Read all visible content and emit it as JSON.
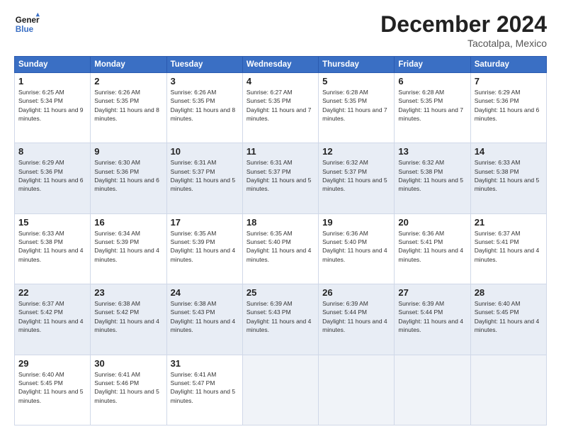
{
  "logo": {
    "line1": "General",
    "line2": "Blue"
  },
  "title": "December 2024",
  "location": "Tacotalpa, Mexico",
  "days_header": [
    "Sunday",
    "Monday",
    "Tuesday",
    "Wednesday",
    "Thursday",
    "Friday",
    "Saturday"
  ],
  "weeks": [
    {
      "shaded": false,
      "days": [
        {
          "num": "1",
          "sunrise": "6:25 AM",
          "sunset": "5:34 PM",
          "daylight": "11 hours and 9 minutes."
        },
        {
          "num": "2",
          "sunrise": "6:26 AM",
          "sunset": "5:35 PM",
          "daylight": "11 hours and 8 minutes."
        },
        {
          "num": "3",
          "sunrise": "6:26 AM",
          "sunset": "5:35 PM",
          "daylight": "11 hours and 8 minutes."
        },
        {
          "num": "4",
          "sunrise": "6:27 AM",
          "sunset": "5:35 PM",
          "daylight": "11 hours and 7 minutes."
        },
        {
          "num": "5",
          "sunrise": "6:28 AM",
          "sunset": "5:35 PM",
          "daylight": "11 hours and 7 minutes."
        },
        {
          "num": "6",
          "sunrise": "6:28 AM",
          "sunset": "5:35 PM",
          "daylight": "11 hours and 7 minutes."
        },
        {
          "num": "7",
          "sunrise": "6:29 AM",
          "sunset": "5:36 PM",
          "daylight": "11 hours and 6 minutes."
        }
      ]
    },
    {
      "shaded": true,
      "days": [
        {
          "num": "8",
          "sunrise": "6:29 AM",
          "sunset": "5:36 PM",
          "daylight": "11 hours and 6 minutes."
        },
        {
          "num": "9",
          "sunrise": "6:30 AM",
          "sunset": "5:36 PM",
          "daylight": "11 hours and 6 minutes."
        },
        {
          "num": "10",
          "sunrise": "6:31 AM",
          "sunset": "5:37 PM",
          "daylight": "11 hours and 5 minutes."
        },
        {
          "num": "11",
          "sunrise": "6:31 AM",
          "sunset": "5:37 PM",
          "daylight": "11 hours and 5 minutes."
        },
        {
          "num": "12",
          "sunrise": "6:32 AM",
          "sunset": "5:37 PM",
          "daylight": "11 hours and 5 minutes."
        },
        {
          "num": "13",
          "sunrise": "6:32 AM",
          "sunset": "5:38 PM",
          "daylight": "11 hours and 5 minutes."
        },
        {
          "num": "14",
          "sunrise": "6:33 AM",
          "sunset": "5:38 PM",
          "daylight": "11 hours and 5 minutes."
        }
      ]
    },
    {
      "shaded": false,
      "days": [
        {
          "num": "15",
          "sunrise": "6:33 AM",
          "sunset": "5:38 PM",
          "daylight": "11 hours and 4 minutes."
        },
        {
          "num": "16",
          "sunrise": "6:34 AM",
          "sunset": "5:39 PM",
          "daylight": "11 hours and 4 minutes."
        },
        {
          "num": "17",
          "sunrise": "6:35 AM",
          "sunset": "5:39 PM",
          "daylight": "11 hours and 4 minutes."
        },
        {
          "num": "18",
          "sunrise": "6:35 AM",
          "sunset": "5:40 PM",
          "daylight": "11 hours and 4 minutes."
        },
        {
          "num": "19",
          "sunrise": "6:36 AM",
          "sunset": "5:40 PM",
          "daylight": "11 hours and 4 minutes."
        },
        {
          "num": "20",
          "sunrise": "6:36 AM",
          "sunset": "5:41 PM",
          "daylight": "11 hours and 4 minutes."
        },
        {
          "num": "21",
          "sunrise": "6:37 AM",
          "sunset": "5:41 PM",
          "daylight": "11 hours and 4 minutes."
        }
      ]
    },
    {
      "shaded": true,
      "days": [
        {
          "num": "22",
          "sunrise": "6:37 AM",
          "sunset": "5:42 PM",
          "daylight": "11 hours and 4 minutes."
        },
        {
          "num": "23",
          "sunrise": "6:38 AM",
          "sunset": "5:42 PM",
          "daylight": "11 hours and 4 minutes."
        },
        {
          "num": "24",
          "sunrise": "6:38 AM",
          "sunset": "5:43 PM",
          "daylight": "11 hours and 4 minutes."
        },
        {
          "num": "25",
          "sunrise": "6:39 AM",
          "sunset": "5:43 PM",
          "daylight": "11 hours and 4 minutes."
        },
        {
          "num": "26",
          "sunrise": "6:39 AM",
          "sunset": "5:44 PM",
          "daylight": "11 hours and 4 minutes."
        },
        {
          "num": "27",
          "sunrise": "6:39 AM",
          "sunset": "5:44 PM",
          "daylight": "11 hours and 4 minutes."
        },
        {
          "num": "28",
          "sunrise": "6:40 AM",
          "sunset": "5:45 PM",
          "daylight": "11 hours and 4 minutes."
        }
      ]
    },
    {
      "shaded": false,
      "days": [
        {
          "num": "29",
          "sunrise": "6:40 AM",
          "sunset": "5:45 PM",
          "daylight": "11 hours and 5 minutes."
        },
        {
          "num": "30",
          "sunrise": "6:41 AM",
          "sunset": "5:46 PM",
          "daylight": "11 hours and 5 minutes."
        },
        {
          "num": "31",
          "sunrise": "6:41 AM",
          "sunset": "5:47 PM",
          "daylight": "11 hours and 5 minutes."
        },
        null,
        null,
        null,
        null
      ]
    }
  ],
  "labels": {
    "sunrise": "Sunrise:",
    "sunset": "Sunset:",
    "daylight": "Daylight:"
  }
}
